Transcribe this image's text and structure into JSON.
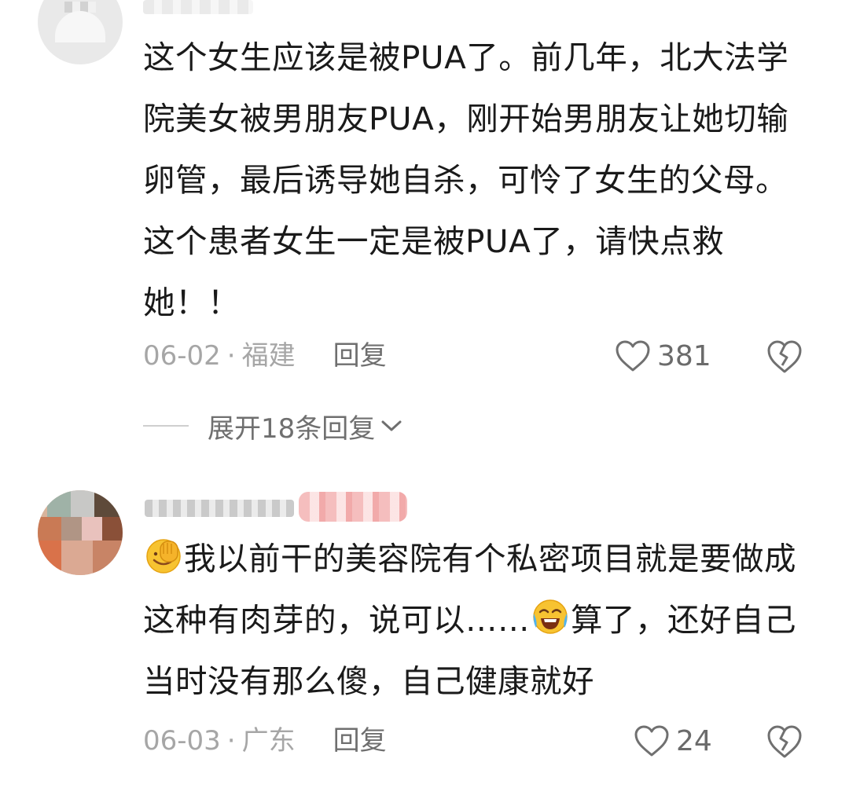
{
  "comments": [
    {
      "text": "这个女生应该是被PUA了。前几年，北大法学院美女被男朋友PUA，刚开始男朋友让她切输卵管，最后诱导她自杀，可怜了女生的父母。这个患者女生一定是被PUA了，请快点救她！！",
      "date": "06-02",
      "location": "福建",
      "reply_label": "回复",
      "likes": "381",
      "expand_label": "展开18条回复"
    },
    {
      "text_part1": "我以前干的美容院有个私密项目就是要做成这种有肉芽的，说可以……",
      "text_part2": "算了，还好自己当时没有那么傻，自己健康就好",
      "date": "06-03",
      "location": "广东",
      "reply_label": "回复",
      "likes": "24"
    }
  ],
  "icons": {
    "like": "heart-outline-icon",
    "dislike": "broken-heart-icon",
    "expand": "chevron-down-icon",
    "emoji_1": "facepalm-emoji-icon",
    "emoji_2": "laughing-crying-emoji-icon"
  },
  "colors": {
    "text": "#1a1a1a",
    "meta": "#a6a6a6",
    "action": "#6f6f6f"
  }
}
